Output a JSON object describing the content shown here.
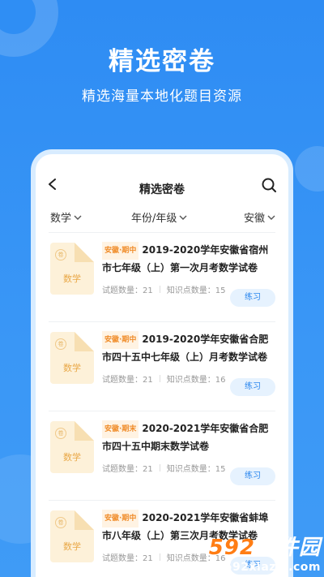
{
  "hero": {
    "title": "精选密卷",
    "subtitle": "精选海量本地化题目资源"
  },
  "topbar": {
    "title": "精选密卷",
    "back_icon": "chevron-left-icon",
    "search_icon": "search-icon"
  },
  "filters": [
    {
      "label": "数学"
    },
    {
      "label": "年份/年级"
    },
    {
      "label": "安徽"
    }
  ],
  "items": [
    {
      "tag": "安徽·期中",
      "title": "2019-2020学年安徽省宿州市七年级（上）第一次月考数学试卷",
      "count_label": "试题数量：21",
      "kp_label": "知识点数量：15",
      "subject": "数学",
      "button": "练习"
    },
    {
      "tag": "安徽·期中",
      "title": "2019-2020学年安徽省合肥市四十五中七年级（上）月考数学试卷",
      "count_label": "试题数量：21",
      "kp_label": "知识点数量：16",
      "subject": "数学",
      "button": "练习"
    },
    {
      "tag": "安徽·期末",
      "title": "2020-2021学年安徽省合肥市四十五中期末数学试卷",
      "count_label": "试题数量：21",
      "kp_label": "知识点数量：15",
      "subject": "数学",
      "button": "练习"
    },
    {
      "tag": "安徽·期中",
      "title": "2020-2021学年安徽省蚌埠市八年级（上）第三次月考数学试卷",
      "count_label": "试题数量：21",
      "kp_label": "知识点数量：16",
      "subject": "数学",
      "button": "练习"
    }
  ],
  "watermark": {
    "logo_num": "592",
    "logo_text": "软件园",
    "url": "www.592xiazai.com"
  },
  "colors": {
    "background": "#2f8ef4",
    "accent": "#2a86ee",
    "tag": "#f08d2b"
  }
}
